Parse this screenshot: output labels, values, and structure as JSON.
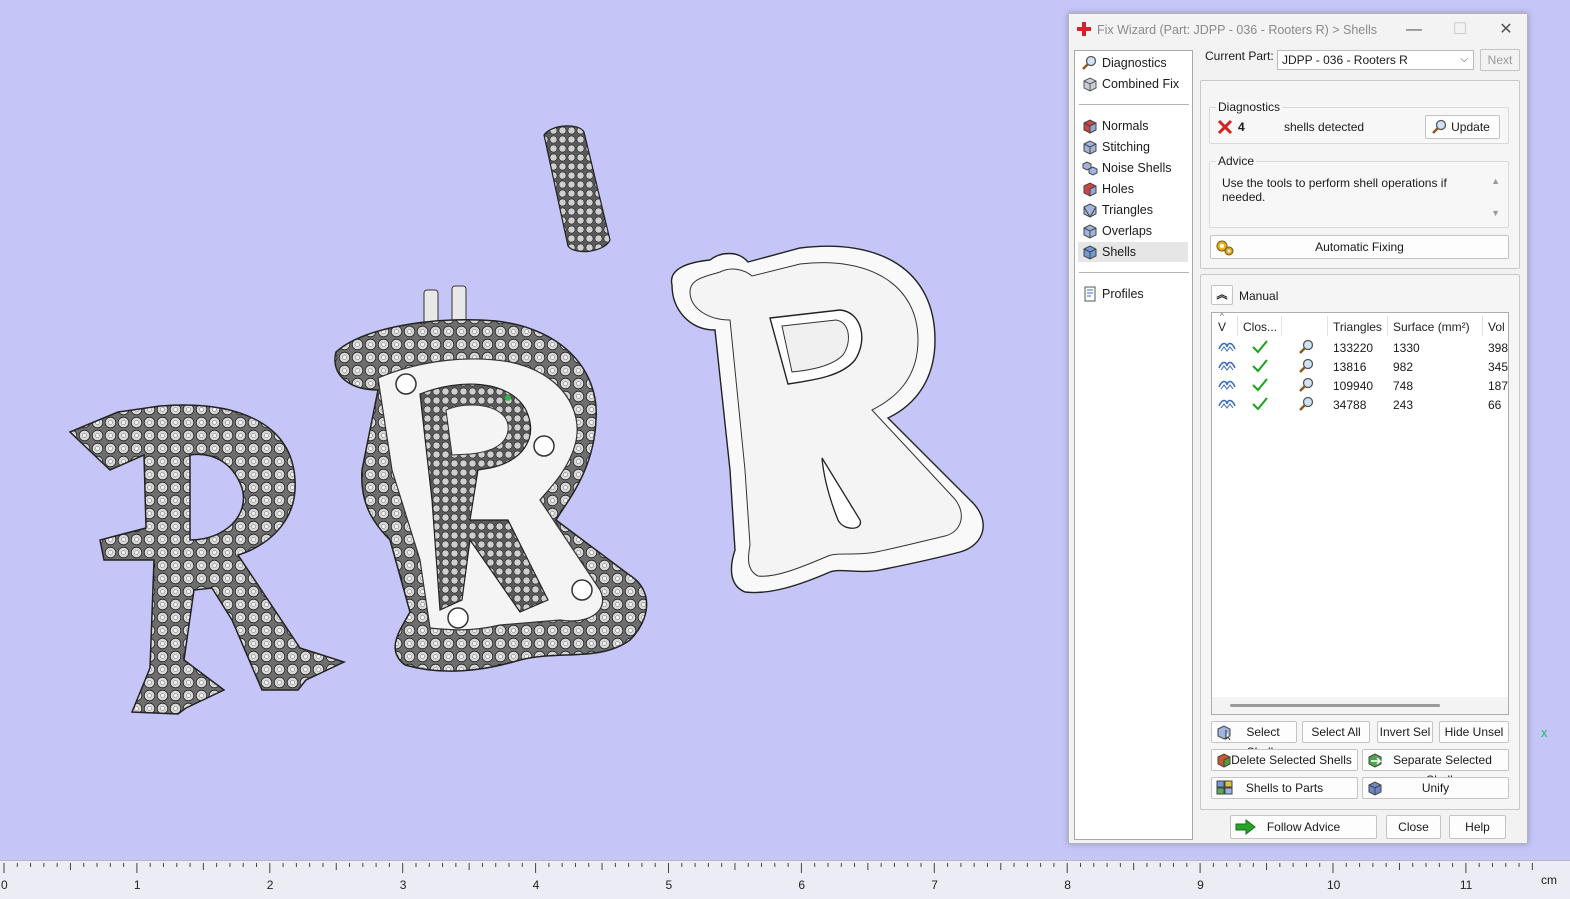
{
  "window": {
    "title": "Fix Wizard (Part: JDPP - 036 - Rooters R) > Shells",
    "minimize": "—",
    "maximize": "☐",
    "close": "✕"
  },
  "nav": {
    "top_items": [
      {
        "label": "Diagnostics",
        "icon": "magnifier-icon"
      },
      {
        "label": "Combined Fix",
        "icon": "combined-fix-icon"
      }
    ],
    "items": [
      {
        "label": "Normals",
        "icon": "normals-cube-icon"
      },
      {
        "label": "Stitching",
        "icon": "stitching-cube-icon"
      },
      {
        "label": "Noise Shells",
        "icon": "noise-shells-icon"
      },
      {
        "label": "Holes",
        "icon": "holes-cube-icon"
      },
      {
        "label": "Triangles",
        "icon": "triangles-cube-icon"
      },
      {
        "label": "Overlaps",
        "icon": "overlaps-cube-icon"
      },
      {
        "label": "Shells",
        "icon": "shells-cube-icon",
        "active": true
      }
    ],
    "bottom_items": [
      {
        "label": "Profiles",
        "icon": "profiles-icon"
      }
    ]
  },
  "current_part": {
    "label": "Current Part:",
    "value": "JDPP - 036 - Rooters R",
    "next": "Next"
  },
  "diagnostics": {
    "legend": "Diagnostics",
    "count": "4",
    "text": "shells detected",
    "update": "Update"
  },
  "advice": {
    "legend": "Advice",
    "text": "Use the tools to perform shell operations if needed."
  },
  "automatic_fixing": "Automatic Fixing",
  "manual": {
    "label": "Manual"
  },
  "table": {
    "headers": [
      "V",
      "Clos...",
      "",
      "Triangles",
      "Surface (mm²)",
      "Vol"
    ],
    "rows": [
      {
        "triangles": "133220",
        "surface": "1330",
        "volume": "398"
      },
      {
        "triangles": "13816",
        "surface": "982",
        "volume": "345"
      },
      {
        "triangles": "109940",
        "surface": "748",
        "volume": "187"
      },
      {
        "triangles": "34788",
        "surface": "243",
        "volume": "66"
      }
    ]
  },
  "buttons": {
    "select_shells": "Select Shells",
    "select_all": "Select All",
    "invert_sel": "Invert Sel",
    "hide_unsel": "Hide Unsel",
    "delete_selected": "Delete Selected Shells",
    "separate_selected": "Separate Selected Shells",
    "shells_to_parts": "Shells to Parts",
    "unify": "Unify",
    "follow_advice": "Follow Advice",
    "close": "Close",
    "help": "Help"
  },
  "ruler": {
    "labels": [
      "0",
      "1",
      "2",
      "3",
      "4",
      "5",
      "6",
      "7",
      "8",
      "9",
      "10",
      "11"
    ],
    "unit": "cm"
  },
  "axis_label": "x",
  "colors": {
    "viewport": "#c5c6f7",
    "check": "#1aa31a",
    "error": "#d42020",
    "arrow": "#28a428"
  }
}
